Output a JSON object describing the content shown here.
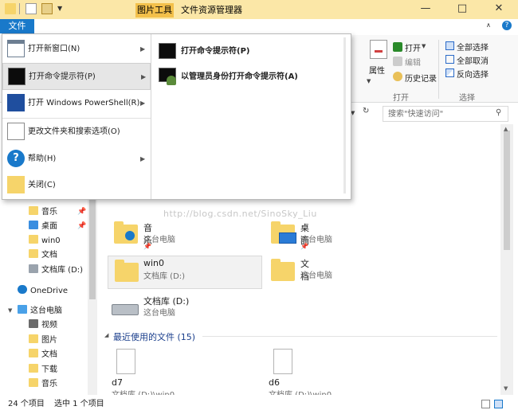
{
  "titlebar": {
    "tools_tab": "图片工具",
    "title": "文件资源管理器",
    "minimize": "—",
    "maximize": "□",
    "close": "✕"
  },
  "ribbon": {
    "file_tab": "文件",
    "help": "?",
    "properties": "属性",
    "open": "打开",
    "edit": "编辑",
    "history": "历史记录",
    "select_all": "全部选择",
    "select_none": "全部取消",
    "invert": "反向选择",
    "group_open": "打开",
    "group_select": "选择"
  },
  "search": {
    "placeholder": "搜索\"快速访问\""
  },
  "file_menu": {
    "items": [
      {
        "label": "打开新窗口(N)",
        "icon": "window-icon"
      },
      {
        "label": "打开命令提示符(P)",
        "icon": "cmd-icon"
      },
      {
        "label": "打开 Windows PowerShell(R)",
        "icon": "powershell-icon"
      },
      {
        "label": "更改文件夹和搜索选项(O)",
        "icon": "options-icon"
      },
      {
        "label": "帮助(H)",
        "icon": "help-icon"
      },
      {
        "label": "关闭(C)",
        "icon": "close-folder-icon"
      }
    ],
    "submenu": [
      {
        "label": "打开命令提示符(P)"
      },
      {
        "label": "以管理员身份打开命令提示符(A)"
      }
    ]
  },
  "nav": {
    "quick": [
      {
        "label": "音乐"
      },
      {
        "label": "桌面"
      },
      {
        "label": "win0"
      },
      {
        "label": "文档"
      },
      {
        "label": "文档库 (D:)"
      }
    ],
    "onedrive": "OneDrive",
    "thispc": "这台电脑",
    "pc_items": [
      {
        "label": "视频"
      },
      {
        "label": "图片"
      },
      {
        "label": "文档"
      },
      {
        "label": "下载"
      },
      {
        "label": "音乐"
      }
    ]
  },
  "content": {
    "folders": [
      {
        "name": "音乐",
        "sub": "这台电脑"
      },
      {
        "name": "桌面",
        "sub": "这台电脑"
      },
      {
        "name": "win0",
        "sub": "文档库 (D:)"
      },
      {
        "name": "文档",
        "sub": "这台电脑"
      },
      {
        "name": "文档库 (D:)",
        "sub": "这台电脑"
      }
    ],
    "recent_header": "最近使用的文件 (15)",
    "recent": [
      {
        "name": "d7",
        "sub": "文档库 (D:)\\win0"
      },
      {
        "name": "d6",
        "sub": "文档库 (D:)\\win0"
      }
    ]
  },
  "watermark": "http://blog.csdn.net/SinoSky_Liu",
  "status": {
    "count": "24 个项目",
    "selected": "选中 1 个项目"
  },
  "colors": {
    "accent": "#1979ca",
    "title_bar": "#fbe7a7",
    "tools_tab": "#f3c04a"
  }
}
